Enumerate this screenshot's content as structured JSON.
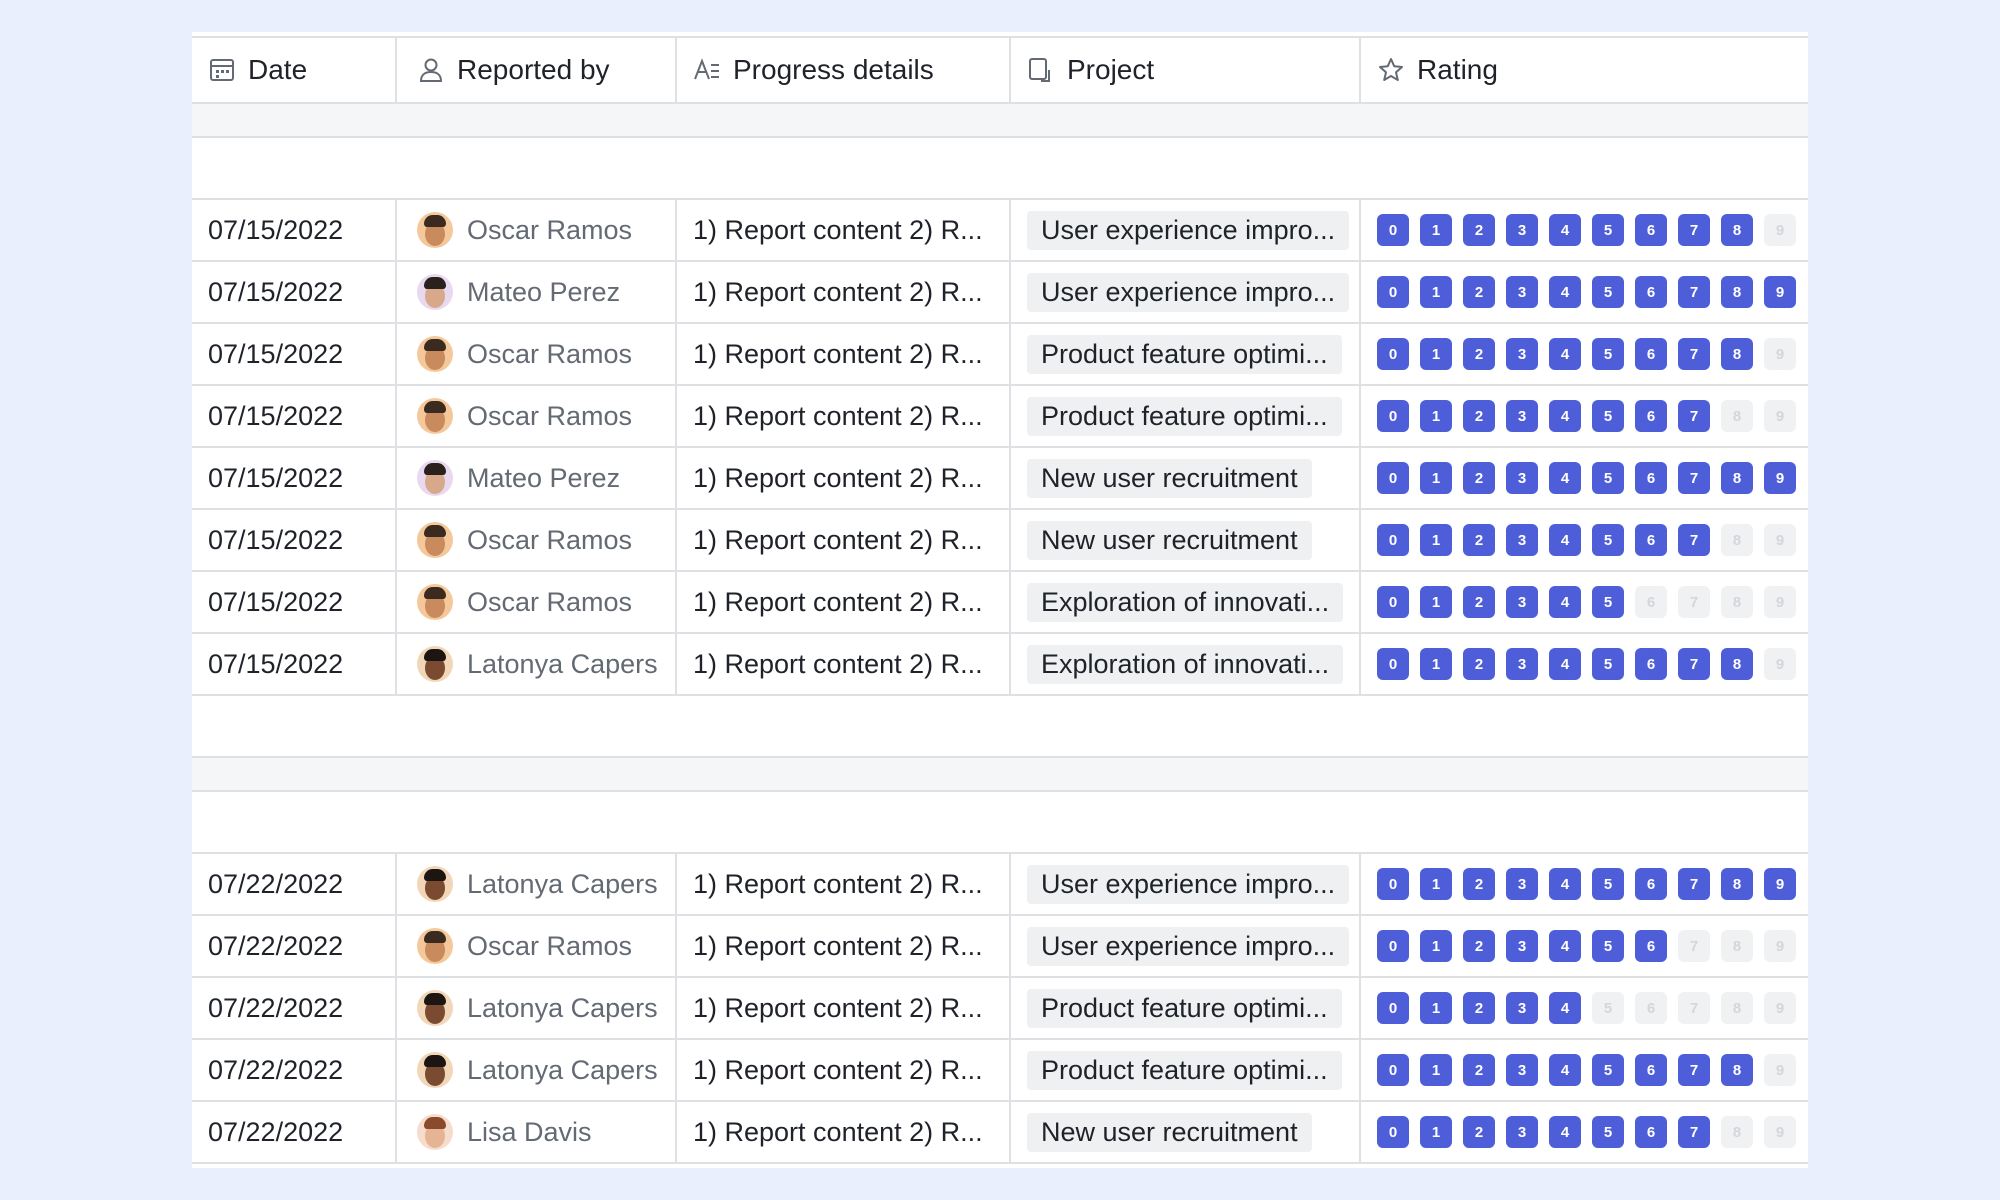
{
  "columns": {
    "date": "Date",
    "reported_by": "Reported by",
    "progress_details": "Progress details",
    "project": "Project",
    "rating": "Rating"
  },
  "rating_scale": [
    "0",
    "1",
    "2",
    "3",
    "4",
    "5",
    "6",
    "7",
    "8",
    "9"
  ],
  "colors": {
    "rating_on": "#4e5ed9",
    "rating_off": "#f0f1f3",
    "page_background": "#e9effc"
  },
  "group1_rows": [
    {
      "date": "07/15/2022",
      "reporter": "Oscar Ramos",
      "avatar": "oscar",
      "details": "1) Report content 2) R...",
      "project": "User experience impro...",
      "rating": 9
    },
    {
      "date": "07/15/2022",
      "reporter": "Mateo Perez",
      "avatar": "mateo",
      "details": "1) Report content 2) R...",
      "project": "User experience impro...",
      "rating": 10
    },
    {
      "date": "07/15/2022",
      "reporter": "Oscar Ramos",
      "avatar": "oscar",
      "details": "1) Report content 2) R...",
      "project": "Product feature optimi...",
      "rating": 9
    },
    {
      "date": "07/15/2022",
      "reporter": "Oscar Ramos",
      "avatar": "oscar",
      "details": "1) Report content 2) R...",
      "project": "Product feature optimi...",
      "rating": 8
    },
    {
      "date": "07/15/2022",
      "reporter": "Mateo Perez",
      "avatar": "mateo",
      "details": "1) Report content 2) R...",
      "project": "New user recruitment",
      "rating": 10
    },
    {
      "date": "07/15/2022",
      "reporter": "Oscar Ramos",
      "avatar": "oscar",
      "details": "1) Report content 2) R...",
      "project": "New user recruitment",
      "rating": 8
    },
    {
      "date": "07/15/2022",
      "reporter": "Oscar Ramos",
      "avatar": "oscar",
      "details": "1) Report content 2) R...",
      "project": "Exploration of innovati...",
      "rating": 6
    },
    {
      "date": "07/15/2022",
      "reporter": "Latonya Capers",
      "avatar": "latonya",
      "details": "1) Report content 2) R...",
      "project": "Exploration of innovati...",
      "rating": 9
    }
  ],
  "group2_rows": [
    {
      "date": "07/22/2022",
      "reporter": "Latonya Capers",
      "avatar": "latonya",
      "details": "1) Report content 2) R...",
      "project": "User experience impro...",
      "rating": 10
    },
    {
      "date": "07/22/2022",
      "reporter": "Oscar Ramos",
      "avatar": "oscar",
      "details": "1) Report content 2) R...",
      "project": "User experience impro...",
      "rating": 7
    },
    {
      "date": "07/22/2022",
      "reporter": "Latonya Capers",
      "avatar": "latonya",
      "details": "1) Report content 2) R...",
      "project": "Product feature optimi...",
      "rating": 5
    },
    {
      "date": "07/22/2022",
      "reporter": "Latonya Capers",
      "avatar": "latonya",
      "details": "1) Report content 2) R...",
      "project": "Product feature optimi...",
      "rating": 9
    },
    {
      "date": "07/22/2022",
      "reporter": "Lisa Davis",
      "avatar": "lisa",
      "details": "1) Report content 2) R...",
      "project": "New user recruitment",
      "rating": 8
    }
  ]
}
